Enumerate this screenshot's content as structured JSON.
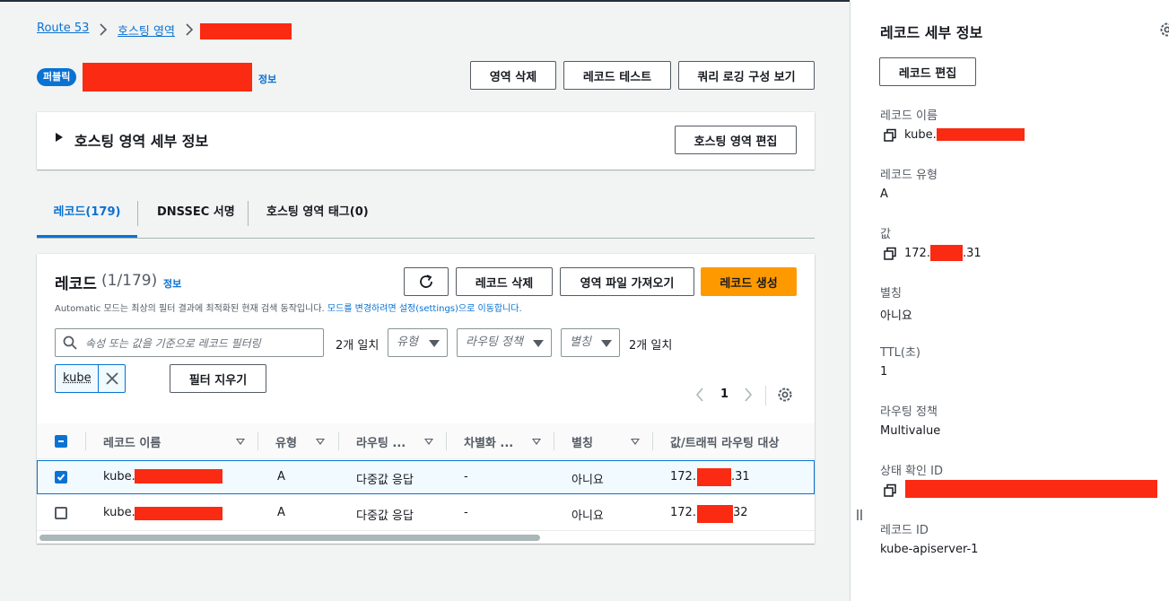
{
  "breadcrumb": {
    "items": [
      "Route 53",
      "호스팅 영역"
    ],
    "separator": ">"
  },
  "header": {
    "badge": "퍼블릭",
    "info_link": "정보",
    "buttons": {
      "delete_zone": "영역 삭제",
      "test_record": "레코드 테스트",
      "query_logging": "쿼리 로깅 구성 보기"
    }
  },
  "zone_details": {
    "title": "호스팅 영역 세부 정보",
    "edit_button": "호스팅 영역 편집"
  },
  "tabs": [
    {
      "label": "레코드(179)",
      "active": true
    },
    {
      "label": "DNSSEC 서명",
      "active": false
    },
    {
      "label": "호스팅 영역 태그(0)",
      "active": false
    }
  ],
  "records_panel": {
    "title": "레코드",
    "count": "(1/179)",
    "info_link": "정보",
    "buttons": {
      "delete": "레코드 삭제",
      "import": "영역 파일 가져오기",
      "create": "레코드 생성"
    },
    "description_plain": "Automatic 모드는 최상의 필터 결과에 최적화된 현재 검색 동작입니다. ",
    "description_link": "모드를 변경하려면 설정(settings)으로 이동합니다.",
    "search": {
      "placeholder": "속성 또는 값을 기준으로 레코드 필터링",
      "matches": "2개 일치"
    },
    "filters": {
      "type": "유형",
      "routing": "라우팅 정책",
      "alias": "별칭",
      "matches": "2개 일치"
    },
    "token": "kube",
    "clear_filter": "필터 지우기",
    "pagination": {
      "page": "1"
    }
  },
  "table": {
    "columns": [
      "레코드 이름",
      "유형",
      "라우팅 ...",
      "차별화 ...",
      "별칭",
      "값/트래픽 라우팅 대상"
    ],
    "rows": [
      {
        "name": "kube.",
        "type": "A",
        "routing": "다중값 응답",
        "diff": "-",
        "alias": "아니요",
        "value_prefix": "172.",
        "value_suffix": ".31",
        "selected": true
      },
      {
        "name": "kube.",
        "type": "A",
        "routing": "다중값 응답",
        "diff": "-",
        "alias": "아니요",
        "value_prefix": "172.",
        "value_suffix": "32",
        "selected": false
      }
    ]
  },
  "detail_panel": {
    "title": "레코드 세부 정보",
    "edit_button": "레코드 편집",
    "fields": [
      {
        "label": "레코드 이름",
        "value": "kube."
      },
      {
        "label": "레코드 유형",
        "value": "A"
      },
      {
        "label": "값",
        "value_prefix": "172.",
        "value_suffix": ".31"
      },
      {
        "label": "별칭",
        "value": "아니요"
      },
      {
        "label": "TTL(초)",
        "value": "1"
      },
      {
        "label": "라우팅 정책",
        "value": "Multivalue"
      },
      {
        "label": "상태 확인 ID",
        "value": ""
      },
      {
        "label": "레코드 ID",
        "value": "kube-apiserver-1"
      }
    ]
  },
  "colors": {
    "accent": "#0972d3",
    "primary_button": "#ff9900",
    "redaction": "#fb2a12"
  },
  "icons": [
    "chevron-right-icon",
    "refresh-icon",
    "search-icon",
    "close-icon",
    "gear-icon",
    "copy-icon",
    "resize-handle-icon",
    "triangle-right-icon",
    "caret-down-icon",
    "chevron-left-icon"
  ]
}
